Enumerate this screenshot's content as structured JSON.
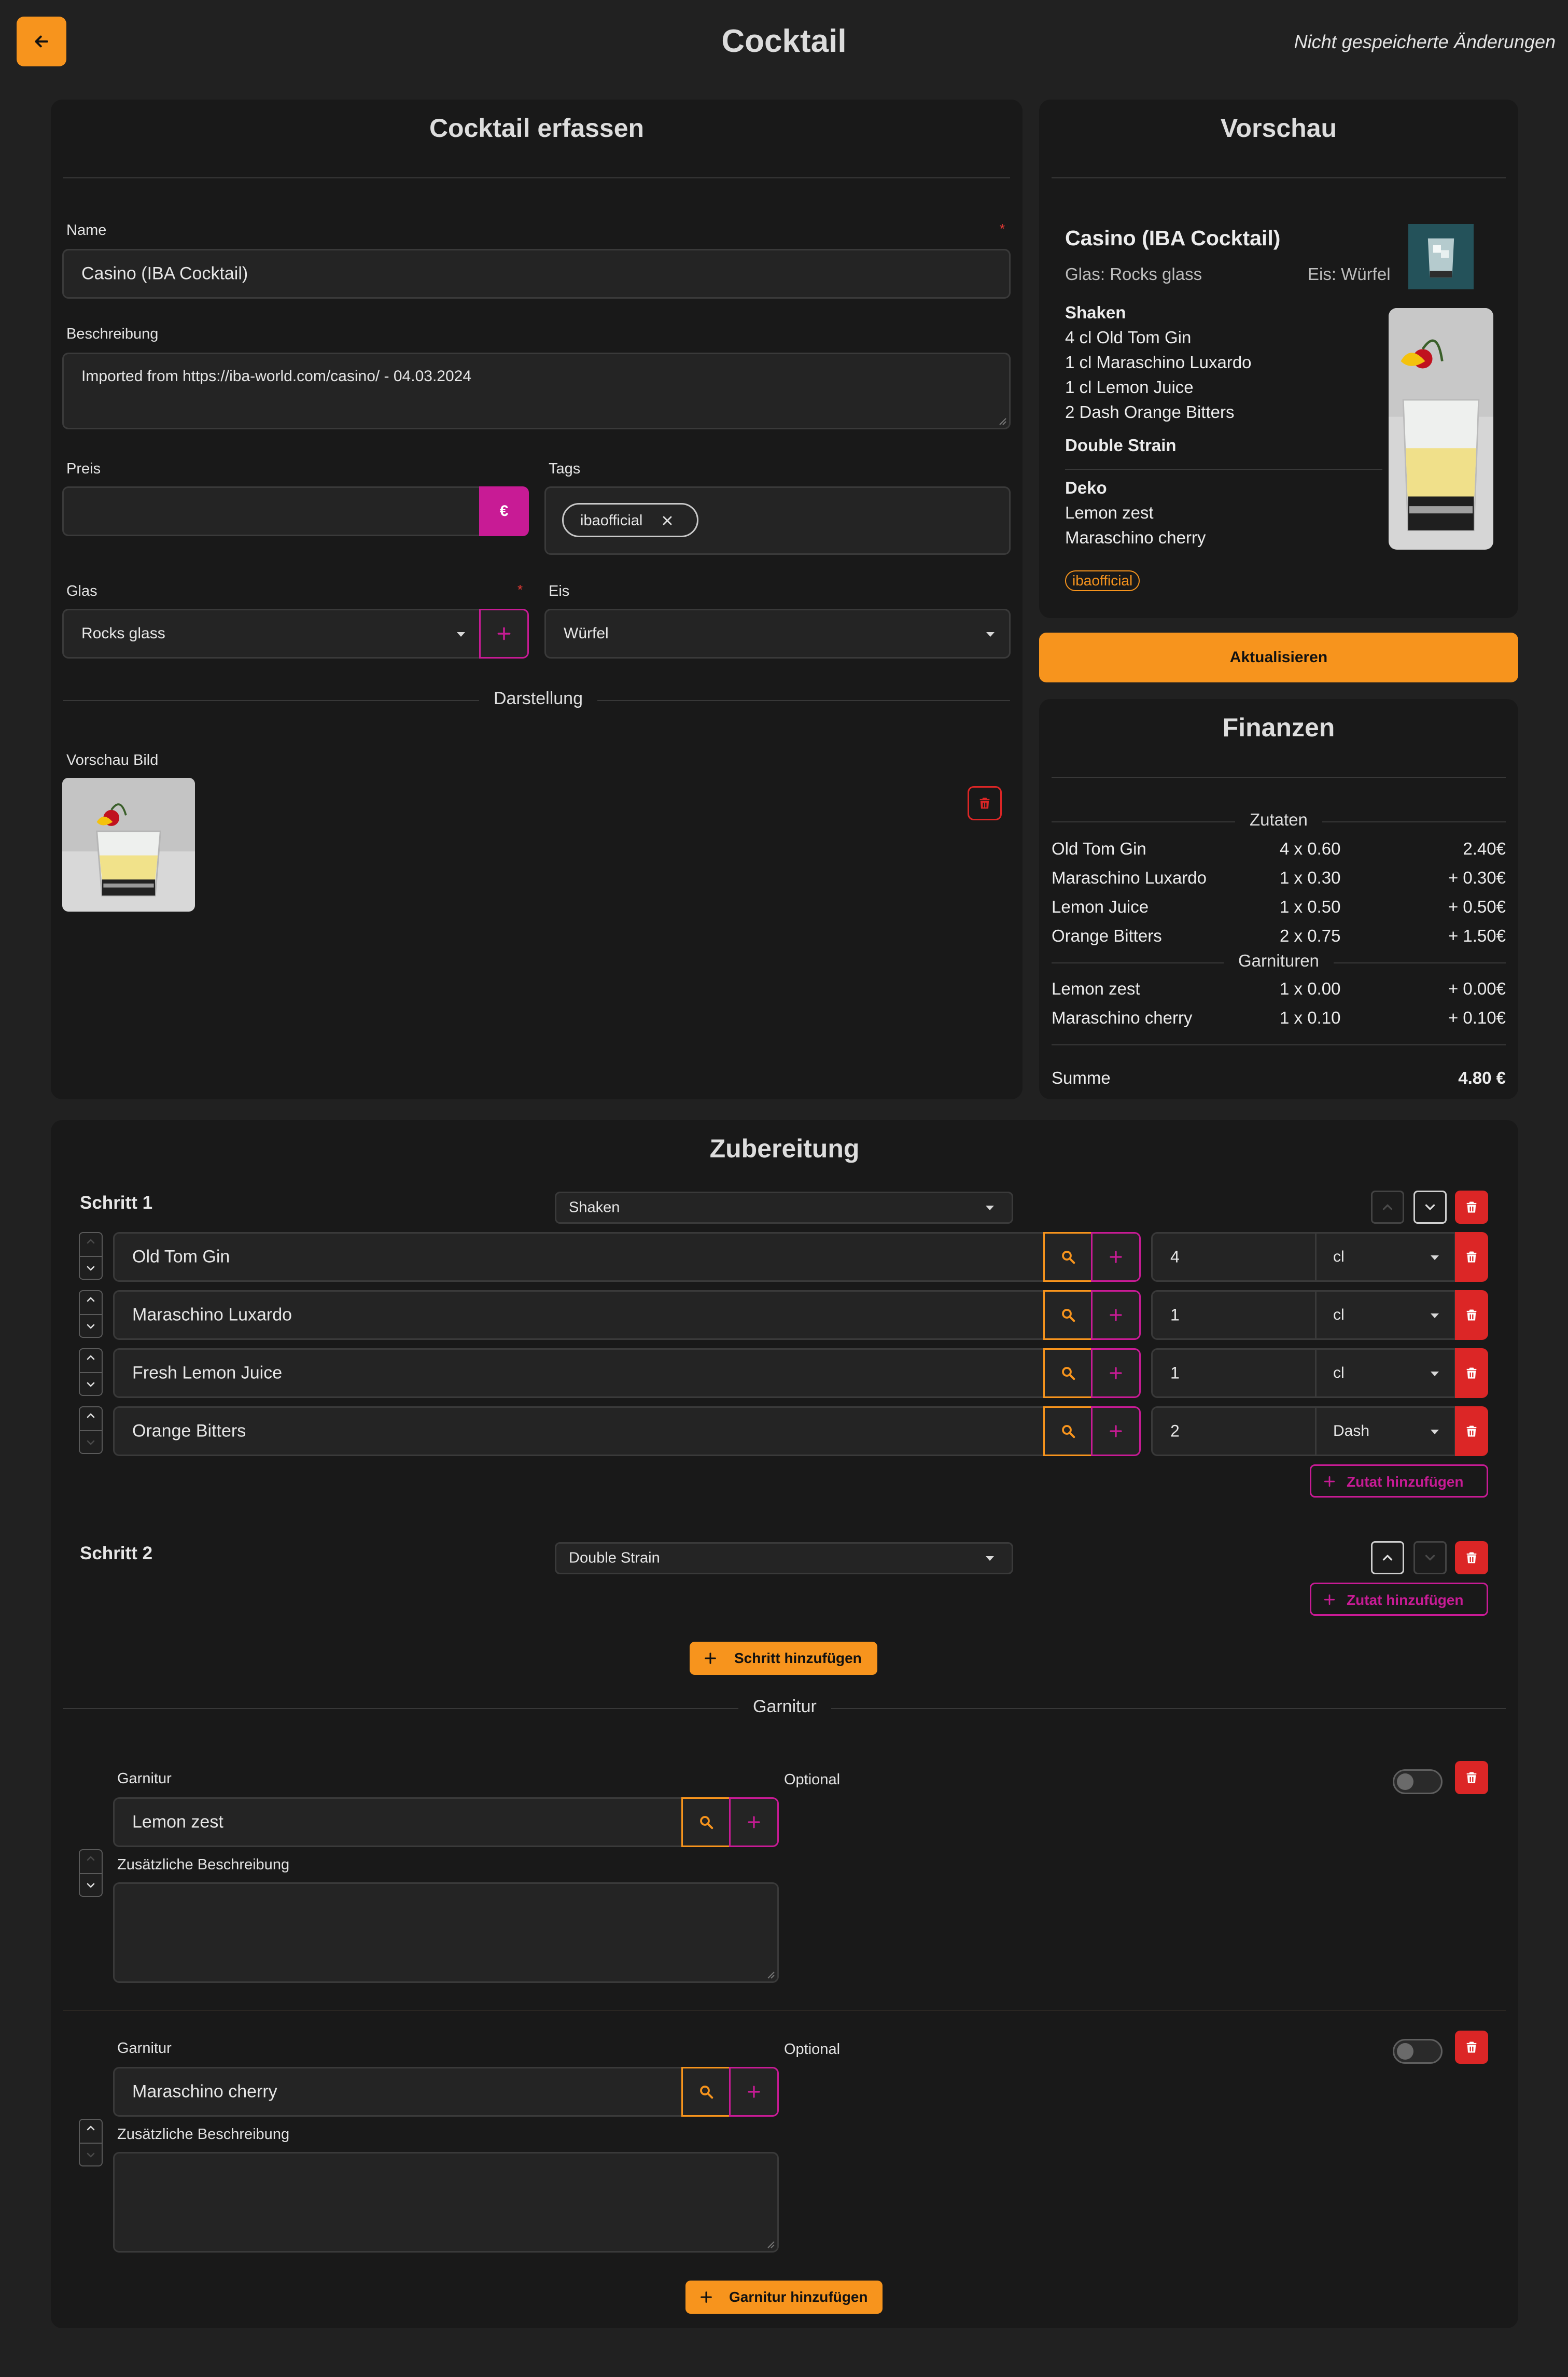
{
  "header": {
    "title": "Cocktail",
    "status": "Nicht gespeicherte Änderungen",
    "back_icon": "arrow-left-icon"
  },
  "colors": {
    "accent": "#f7941d",
    "secondary": "#c81b95",
    "danger": "#dc2626",
    "background": "#212121",
    "card": "#191919"
  },
  "form": {
    "title": "Cocktail erfassen",
    "name_label": "Name",
    "name_required": "*",
    "name_value": "Casino (IBA Cocktail)",
    "description_label": "Beschreibung",
    "description_value": "Imported from https://iba-world.com/casino/ - 04.03.2024",
    "price_label": "Preis",
    "price_value": "",
    "currency": "€",
    "tags_label": "Tags",
    "tags": [
      "ibaofficial"
    ],
    "glass_label": "Glas",
    "glass_required": "*",
    "glass_value": "Rocks glass",
    "ice_label": "Eis",
    "ice_value": "Würfel",
    "display_separator": "Darstellung",
    "preview_image_label": "Vorschau Bild"
  },
  "preview": {
    "title": "Vorschau",
    "cocktail_name": "Casino (IBA Cocktail)",
    "glass": "Glas: Rocks glass",
    "ice": "Eis: Würfel",
    "step1_method": "Shaken",
    "step1_ingredients": [
      "4 cl Old Tom Gin",
      "1 cl Maraschino Luxardo",
      "1 cl Lemon Juice",
      "2 Dash Orange Bitters"
    ],
    "step2_method": "Double Strain",
    "garnish_title": "Deko",
    "garnishes": [
      "Lemon zest",
      "Maraschino cherry"
    ],
    "tag": "ibaofficial",
    "update_button": "Aktualisieren"
  },
  "finance": {
    "title": "Finanzen",
    "ingredients_heading": "Zutaten",
    "ingredients": [
      {
        "name": "Old Tom Gin",
        "calc": "4 x 0.60",
        "total": "2.40€"
      },
      {
        "name": "Maraschino Luxardo",
        "calc": "1 x 0.30",
        "total": "+ 0.30€"
      },
      {
        "name": "Lemon Juice",
        "calc": "1 x 0.50",
        "total": "+ 0.50€"
      },
      {
        "name": "Orange Bitters",
        "calc": "2 x 0.75",
        "total": "+ 1.50€"
      }
    ],
    "garnish_heading": "Garnituren",
    "garnishes": [
      {
        "name": "Lemon zest",
        "calc": "1 x 0.00",
        "total": "+ 0.00€"
      },
      {
        "name": "Maraschino cherry",
        "calc": "1 x 0.10",
        "total": "+ 0.10€"
      }
    ],
    "sum_label": "Summe",
    "sum_value": "4.80 €"
  },
  "preparation": {
    "title": "Zubereitung",
    "steps": [
      {
        "label": "Schritt 1",
        "method": "Shaken",
        "ingredients": [
          {
            "name": "Old Tom Gin",
            "amount": "4",
            "unit": "cl"
          },
          {
            "name": "Maraschino Luxardo",
            "amount": "1",
            "unit": "cl"
          },
          {
            "name": "Fresh Lemon Juice",
            "amount": "1",
            "unit": "cl"
          },
          {
            "name": "Orange Bitters",
            "amount": "2",
            "unit": "Dash"
          }
        ],
        "add_ingredient": "Zutat hinzufügen"
      },
      {
        "label": "Schritt 2",
        "method": "Double Strain",
        "ingredients": [],
        "add_ingredient": "Zutat hinzufügen"
      }
    ],
    "add_step": "Schritt hinzufügen",
    "garnish_separator": "Garnitur",
    "garnishes": [
      {
        "label": "Garnitur",
        "value": "Lemon zest",
        "optional_label": "Optional",
        "optional": false,
        "extra_label": "Zusätzliche Beschreibung",
        "extra_value": ""
      },
      {
        "label": "Garnitur",
        "value": "Maraschino cherry",
        "optional_label": "Optional",
        "optional": false,
        "extra_label": "Zusätzliche Beschreibung",
        "extra_value": ""
      }
    ],
    "add_garnish": "Garnitur hinzufügen"
  }
}
